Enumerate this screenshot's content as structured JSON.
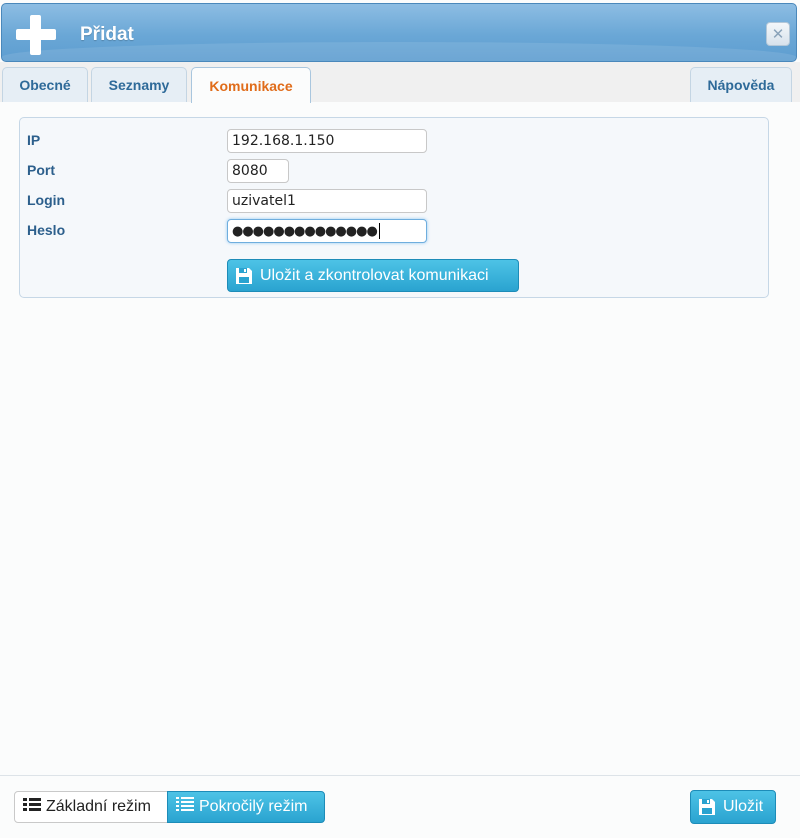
{
  "dialog": {
    "title": "Přidat"
  },
  "tabs": [
    {
      "label": "Obecné"
    },
    {
      "label": "Seznamy"
    },
    {
      "label": "Komunikace"
    },
    {
      "label": "Nápověda"
    }
  ],
  "form": {
    "ip_label": "IP",
    "ip_value": "192.168.1.150",
    "port_label": "Port",
    "port_value": "8080",
    "login_label": "Login",
    "login_value": "uzivatel1",
    "password_label": "Heslo",
    "password_value": "●●●●●●●●●●●●●●",
    "save_check_label": "Uložit a zkontrolovat komunikaci"
  },
  "footer": {
    "basic_mode_label": "Základní režim",
    "advanced_mode_label": "Pokročilý režim",
    "save_label": "Uložit"
  }
}
